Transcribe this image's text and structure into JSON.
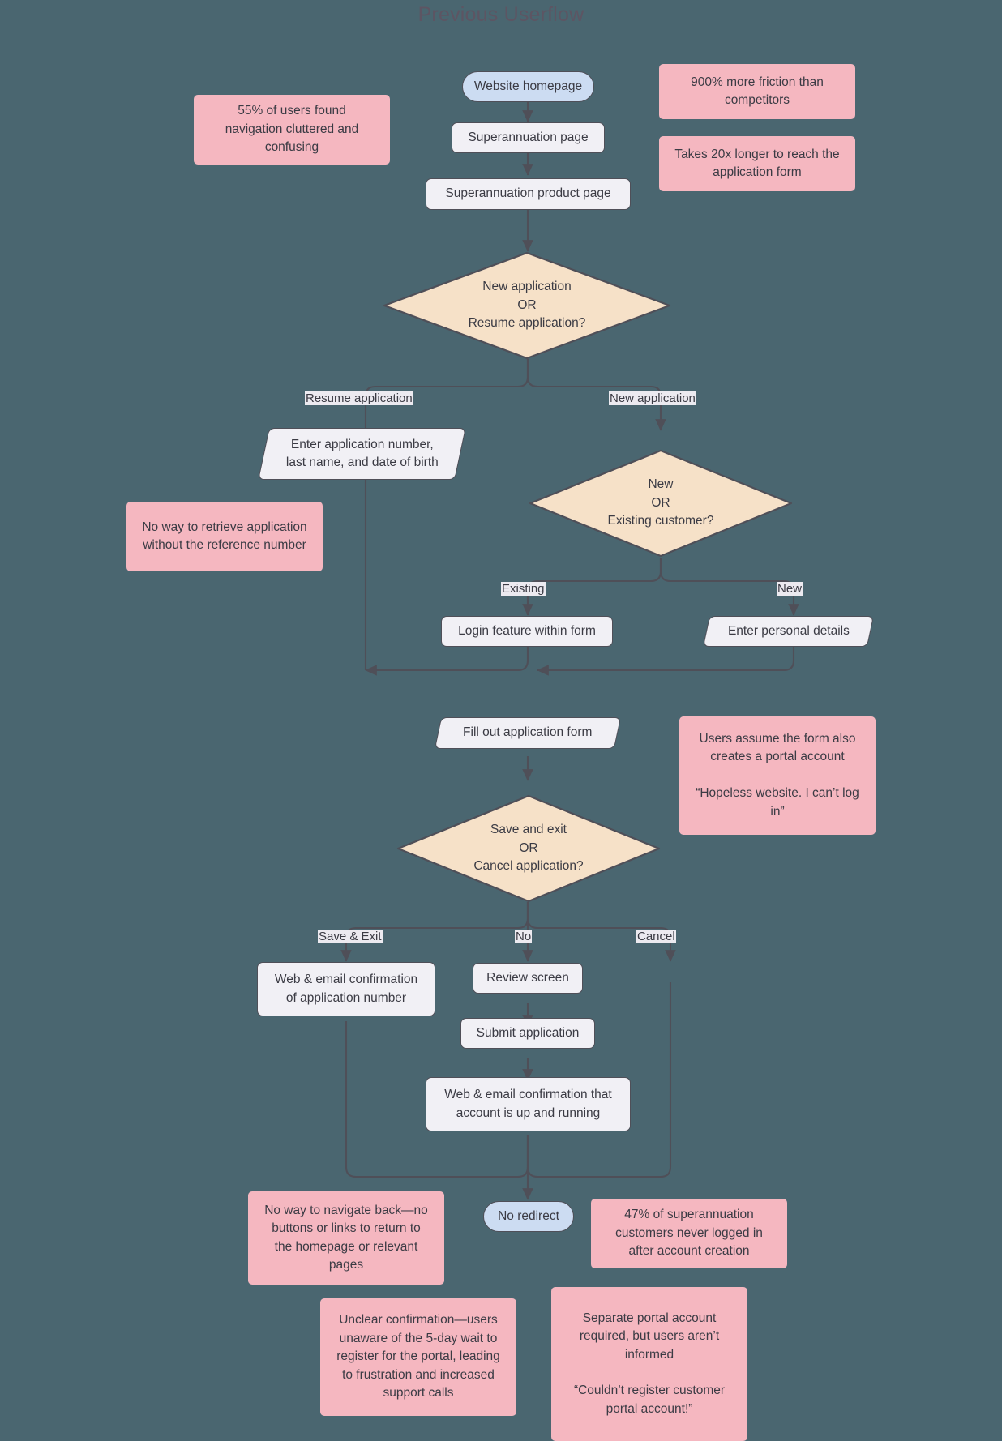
{
  "title": "Previous Userflow",
  "theme": {
    "background": "#4a6670",
    "process_fill": "#f1f0f5",
    "terminator_fill": "#ccdcf2",
    "decision_fill": "#f6e1c8",
    "note_fill": "#f5b7c0",
    "stroke": "#4f4f58",
    "text": "#3b3b44",
    "title_color": "#5d5563"
  },
  "nodes": {
    "website_homepage": {
      "label": "Website homepage",
      "shape": "terminator"
    },
    "superannuation_page": {
      "label": "Superannuation page",
      "shape": "process"
    },
    "superannuation_product_page": {
      "label": "Superannuation product page",
      "shape": "process"
    },
    "decision_new_or_resume": {
      "shape": "decision",
      "line1": "New application",
      "line2": "OR",
      "line3": "Resume application?"
    },
    "enter_application_number": {
      "shape": "input",
      "line1": "Enter application number,",
      "line2": "last name, and date of birth"
    },
    "decision_new_or_existing": {
      "shape": "decision",
      "line1": "New",
      "line2": "OR",
      "line3": "Existing customer?"
    },
    "login_feature": {
      "label": "Login feature within form",
      "shape": "process"
    },
    "enter_personal_details": {
      "label": "Enter personal details",
      "shape": "input"
    },
    "fill_out_application_form": {
      "label": "Fill out application form",
      "shape": "input"
    },
    "decision_save_or_cancel": {
      "shape": "decision",
      "line1": "Save and exit",
      "line2": "OR",
      "line3": "Cancel application?"
    },
    "web_email_confirmation_number": {
      "shape": "process",
      "line1": "Web & email confirmation",
      "line2": "of application number"
    },
    "review_screen": {
      "label": "Review screen",
      "shape": "process"
    },
    "submit_application": {
      "label": "Submit application",
      "shape": "process"
    },
    "web_email_confirmation_account": {
      "shape": "process",
      "line1": "Web & email confirmation that",
      "line2": "account is up and running"
    },
    "no_redirect": {
      "label": "No redirect",
      "shape": "terminator"
    }
  },
  "edge_labels": {
    "resume_application": "Resume application",
    "new_application": "New application",
    "existing": "Existing",
    "new": "New",
    "save_and_exit": "Save & Exit",
    "no": "No",
    "cancel": "Cancel"
  },
  "notes": {
    "navigation_cluttered": {
      "paragraphs": [
        "55% of users found navigation cluttered and confusing"
      ]
    },
    "more_friction": {
      "paragraphs": [
        "900% more friction than competitors"
      ]
    },
    "takes_longer": {
      "paragraphs": [
        "Takes 20x longer to reach the application form"
      ]
    },
    "no_way_to_retrieve": {
      "paragraphs": [
        "No way to retrieve application without the reference number"
      ]
    },
    "users_assume_portal": {
      "paragraphs": [
        "Users assume the form also creates a portal account",
        "“Hopeless website. I can’t log in”"
      ]
    },
    "no_way_to_navigate_back": {
      "paragraphs": [
        "No way to navigate back—no buttons or links to return to the homepage or relevant pages"
      ]
    },
    "never_logged_in": {
      "paragraphs": [
        "47% of superannuation customers never logged in after account creation"
      ]
    },
    "unclear_confirmation": {
      "paragraphs": [
        "Unclear confirmation—users unaware of the 5-day wait to register for the portal, leading to frustration and increased support calls"
      ]
    },
    "separate_portal_account": {
      "paragraphs": [
        "Separate portal account required, but users aren’t informed",
        "“Couldn’t register customer portal account!”"
      ]
    }
  }
}
